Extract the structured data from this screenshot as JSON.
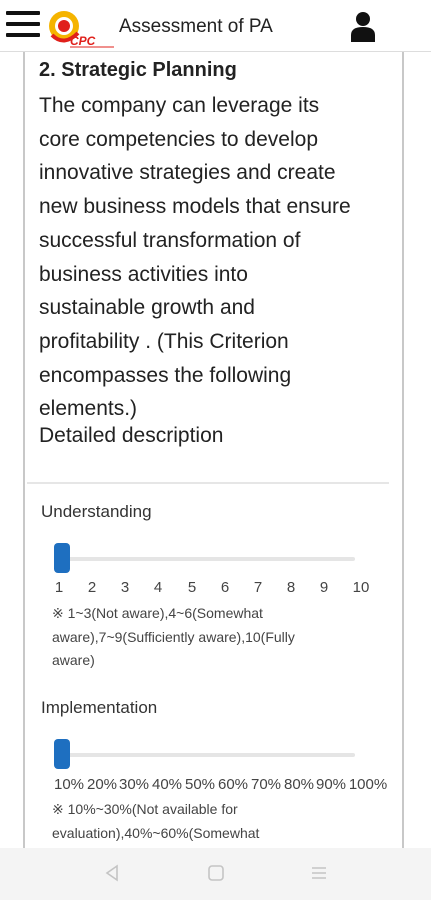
{
  "header": {
    "title": "Assessment of PA",
    "logo_text": "CPC",
    "menu_icon": "hamburger-menu-icon",
    "user_icon": "user-profile-icon"
  },
  "section": {
    "title": "2. Strategic Planning",
    "lines": [
      "The company can leverage its",
      "core competencies to develop",
      "innovative strategies and create",
      "new business models that ensure",
      "successful transformation of",
      "business activities into",
      "sustainable growth and",
      "profitability . (This Criterion",
      "encompasses the following",
      "elements.)"
    ],
    "detailed_link": "Detailed description"
  },
  "understanding": {
    "label": "Understanding",
    "value": 1,
    "ticks": [
      "1",
      "2",
      "3",
      "4",
      "5",
      "6",
      "7",
      "8",
      "9",
      "10"
    ],
    "note_lines": [
      "※ 1~3(Not aware),4~6(Somewhat",
      "aware),7~9(Sufficiently aware),10(Fully",
      "aware)"
    ]
  },
  "implementation": {
    "label": "Implementation",
    "value": "10%",
    "ticks": [
      "10%",
      "20%",
      "30%",
      "40%",
      "50%",
      "60%",
      "70%",
      "80%",
      "90%",
      "100%"
    ],
    "note_lines": [
      "※ 10%~30%(Not available for",
      "evaluation),40%~60%(Somewhat"
    ]
  },
  "colors": {
    "accent": "#1e6fc0",
    "logo_red": "#e0201b",
    "logo_yellow": "#f5b400"
  },
  "navbar": {
    "icons": [
      "back-triangle-icon",
      "home-square-icon",
      "recents-menu-icon"
    ]
  }
}
